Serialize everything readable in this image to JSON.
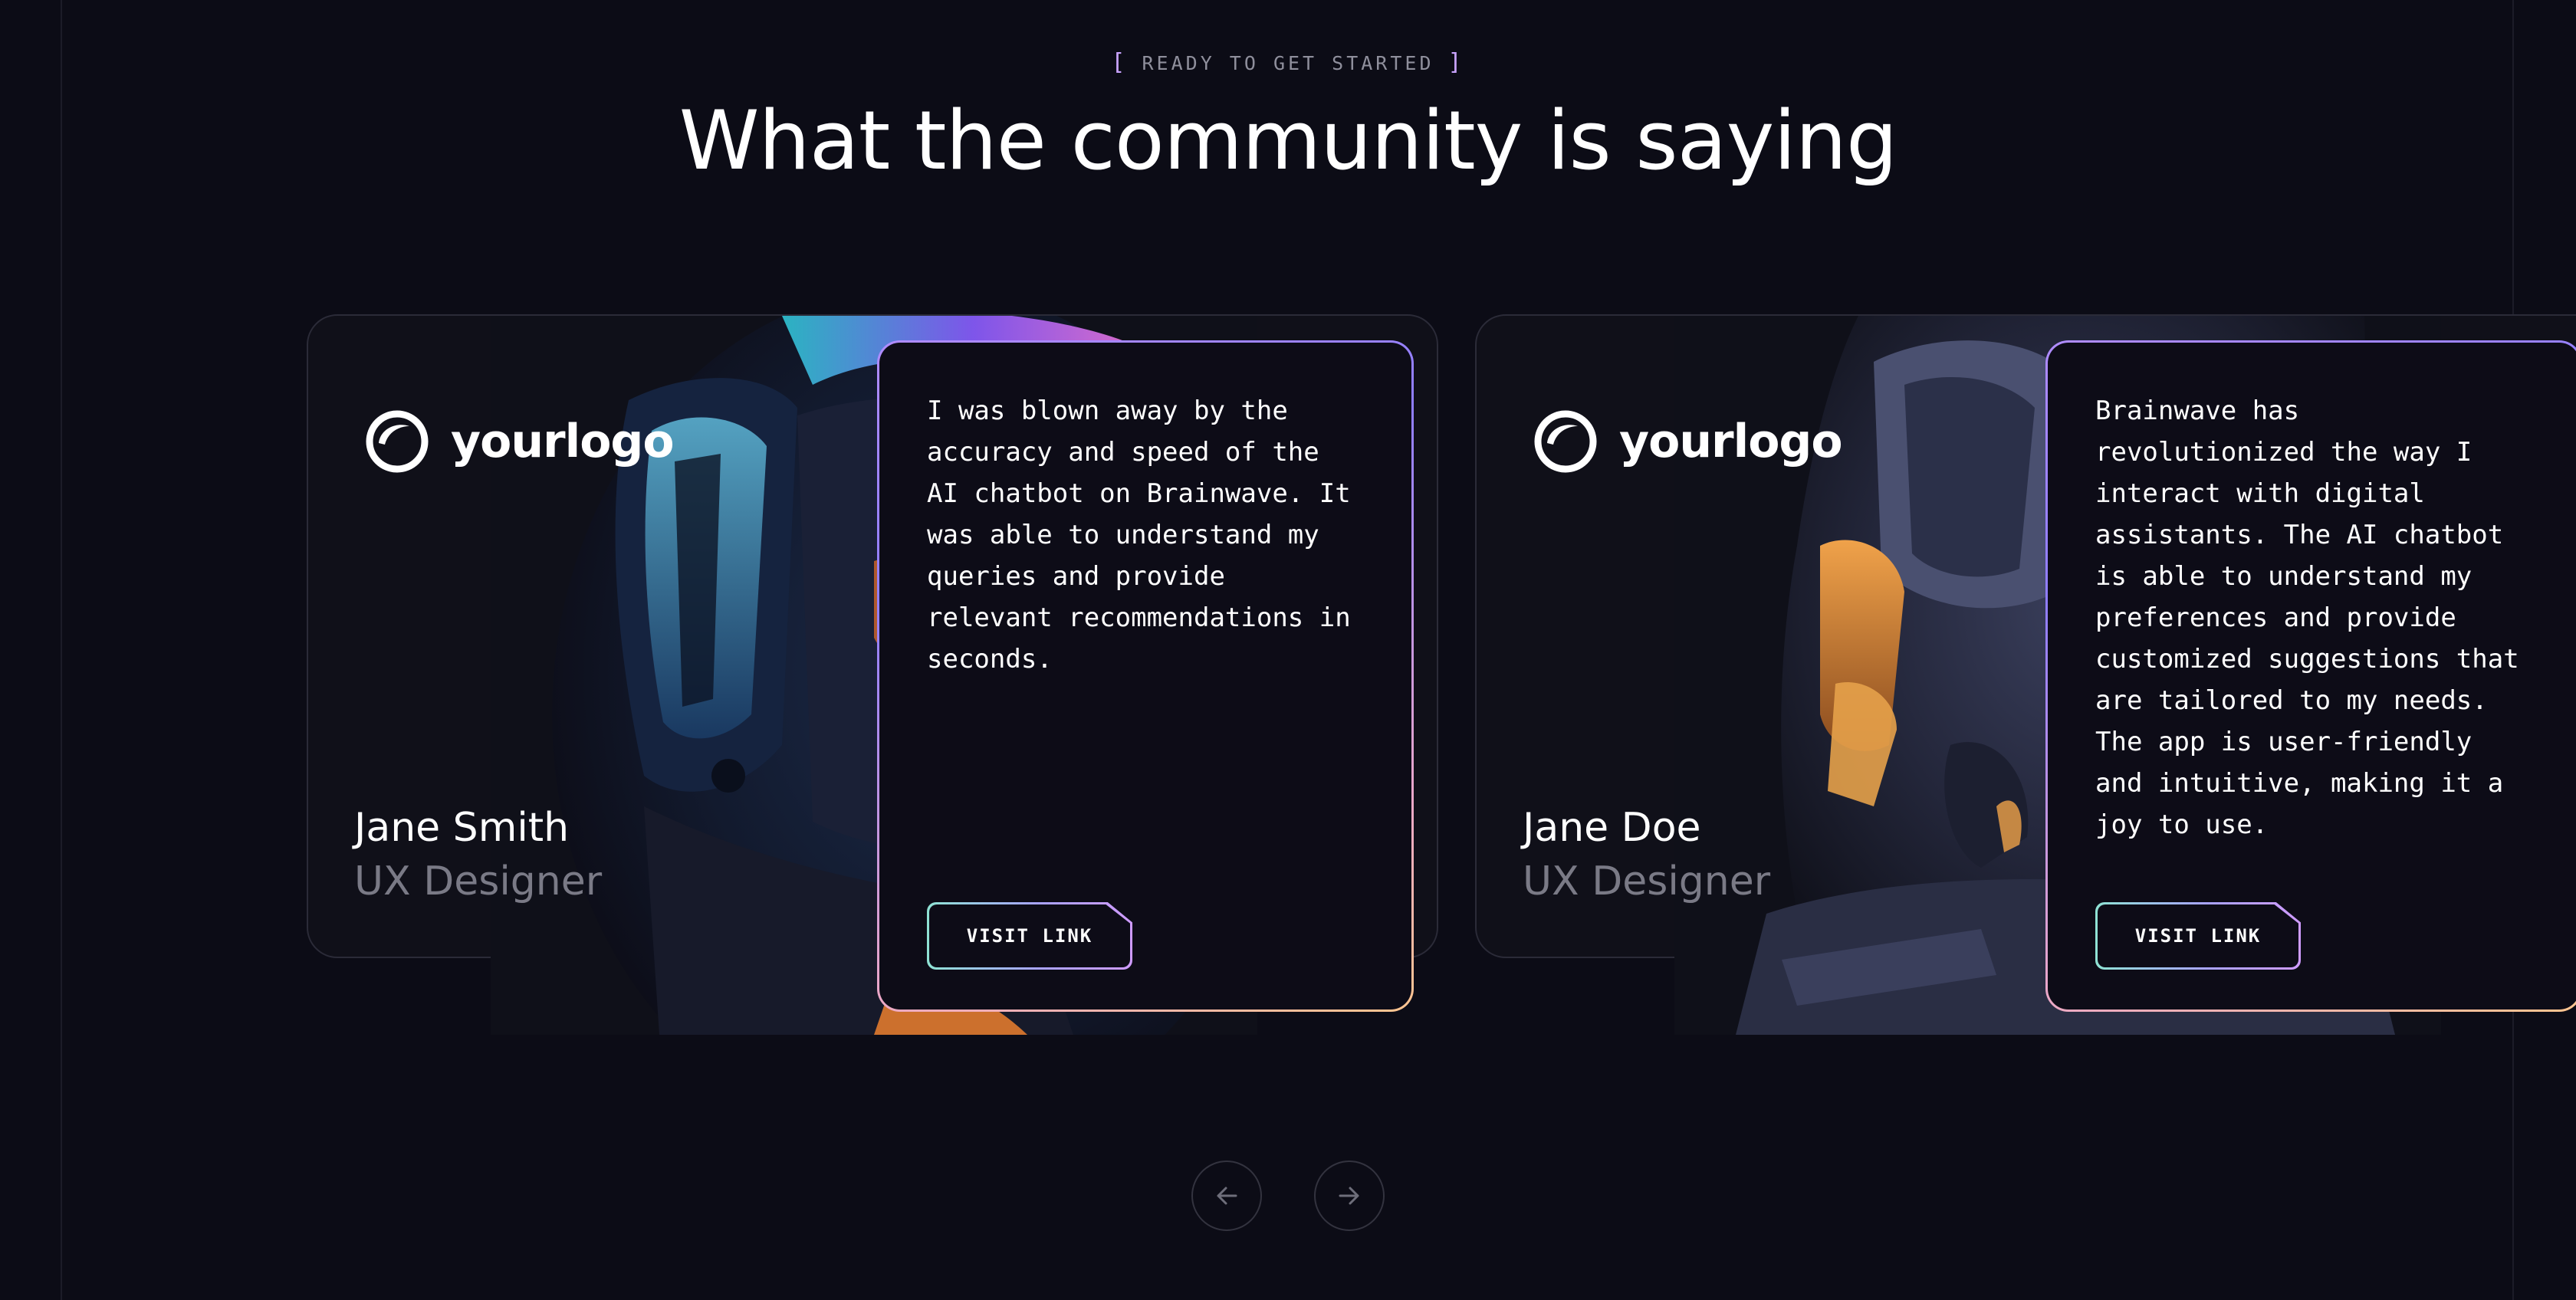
{
  "section": {
    "eyebrow_open": "[",
    "eyebrow_text": "READY TO GET STARTED",
    "eyebrow_close": "]",
    "headline": "What the community is saying"
  },
  "testimonials": [
    {
      "logo_text": "yourlogo",
      "name": "Jane Smith",
      "role": "UX Designer",
      "quote": "I was blown away by the accuracy and speed of the AI chatbot on Brainwave. It was able to understand my queries and provide relevant recommendations in seconds.",
      "button_label": "VISIT LINK"
    },
    {
      "logo_text": "yourlogo",
      "name": "Jane Doe",
      "role": "UX Designer",
      "quote": "Brainwave has revolutionized the way I interact with digital assistants. The AI chatbot is able to understand my preferences and provide customized suggestions that are tailored to my needs. The app is user-friendly and intuitive, making it a joy to use.",
      "button_label": "VISIT LINK"
    }
  ],
  "navigation": {
    "prev_icon": "arrow-left-icon",
    "next_icon": "arrow-right-icon"
  },
  "colors": {
    "background": "#0c0c16",
    "card_border": "#2b2b38",
    "accent_purple": "#b08cff",
    "accent_orange": "#ffc58f",
    "accent_teal": "#8fe3d4",
    "muted_text": "#7a7a86"
  }
}
